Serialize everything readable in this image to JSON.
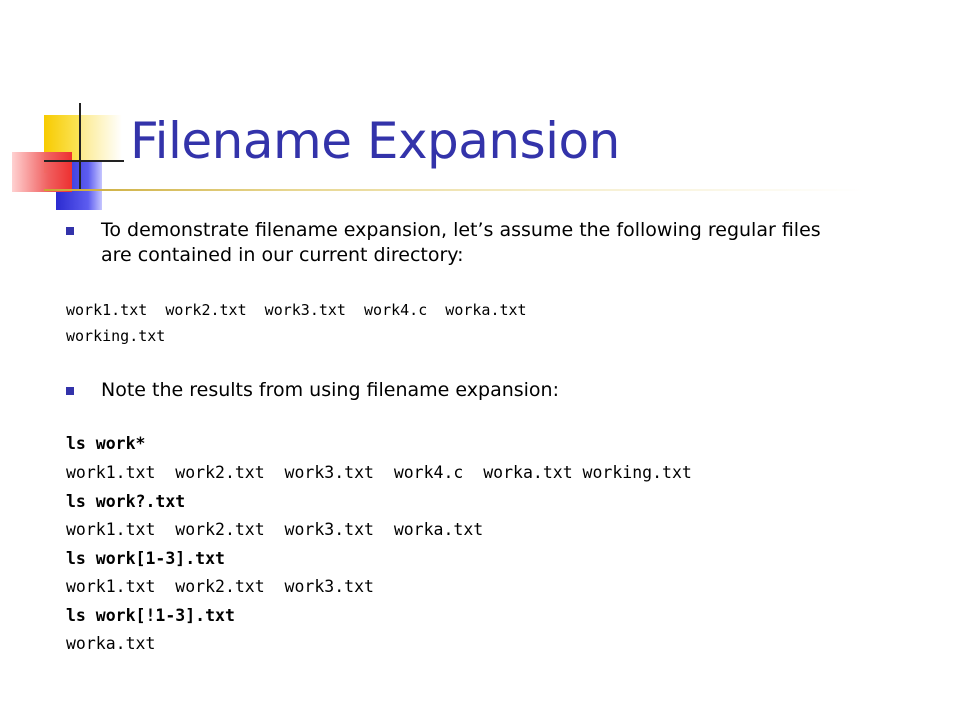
{
  "slide": {
    "title": "Filename Expansion",
    "accent_color": "#3333aa",
    "bullets": [
      {
        "lines": [
          "To demonstrate filename expansion, let’s assume the following regular files",
          "are contained in our current directory:"
        ]
      },
      {
        "lines": [
          "Note the results from using filename expansion:"
        ]
      }
    ],
    "file_list": [
      "work1.txt  work2.txt  work3.txt  work4.c  worka.txt",
      "working.txt"
    ],
    "examples": [
      {
        "command": "ls work*",
        "output": "work1.txt  work2.txt  work3.txt  work4.c  worka.txt working.txt"
      },
      {
        "command": "ls work?.txt",
        "output": "work1.txt  work2.txt  work3.txt  worka.txt"
      },
      {
        "command": "ls work[1-3].txt",
        "output": "work1.txt  work2.txt  work3.txt"
      },
      {
        "command": "ls work[!1-3].txt",
        "output": "worka.txt"
      }
    ]
  }
}
